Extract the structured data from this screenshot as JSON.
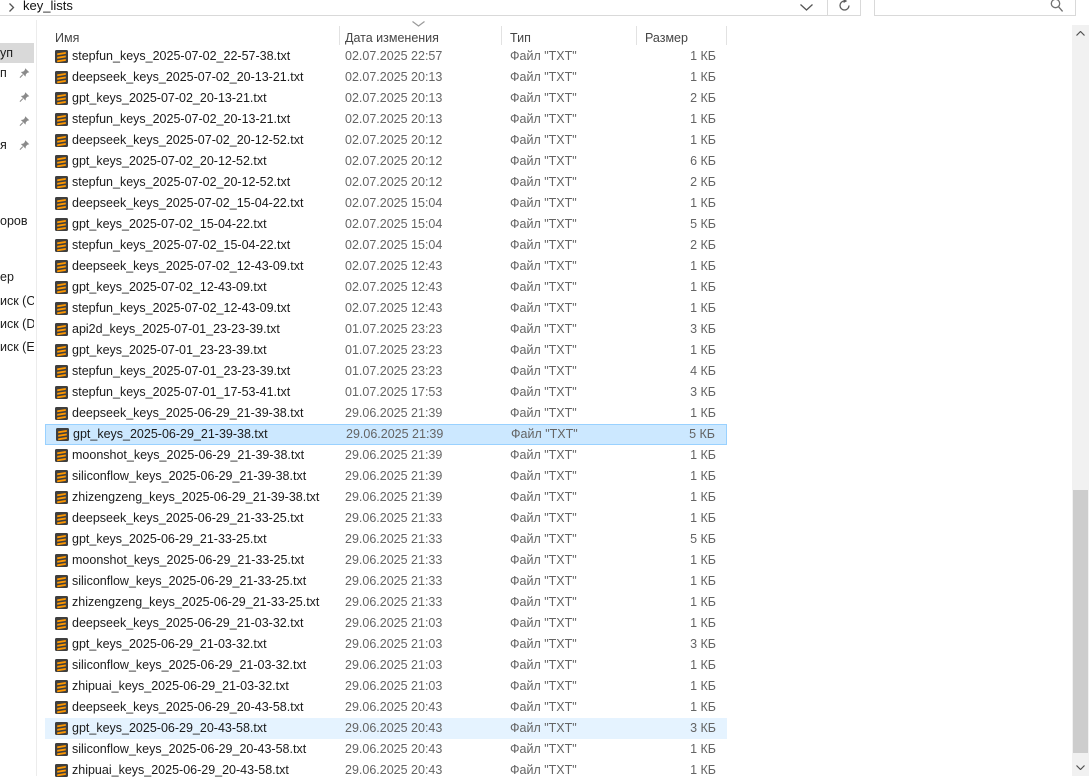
{
  "colors": {
    "selection_bg": "#cce8ff",
    "selection_border": "#99d1ff",
    "hover_bg": "#e5f3ff",
    "nav_selected_bg": "#d9d9d9",
    "file_icon_bg": "#3f3f3f",
    "file_icon_accent": "#ff9800"
  },
  "address_bar": {
    "breadcrumb_chevron_icon": "chevron-right",
    "path_segment": "key_lists",
    "dropdown_icon": "chevron-down",
    "refresh_icon": "refresh"
  },
  "search_box": {
    "value": "",
    "icon": "magnifier"
  },
  "nav_pane": {
    "items": [
      {
        "label_fragment": "уп",
        "selected": true,
        "pinned": false
      },
      {
        "label_fragment": "п",
        "selected": false,
        "pinned": true
      },
      {
        "label_fragment": "",
        "selected": false,
        "pinned": true
      },
      {
        "label_fragment": "",
        "selected": false,
        "pinned": true
      },
      {
        "label_fragment": "я",
        "selected": false,
        "pinned": true
      },
      {
        "label_fragment": "оров",
        "selected": false,
        "pinned": false
      },
      {
        "label_fragment": "ер",
        "selected": false,
        "pinned": false
      },
      {
        "label_fragment": "иск (C",
        "selected": false,
        "pinned": false
      },
      {
        "label_fragment": "иск (D",
        "selected": false,
        "pinned": false
      },
      {
        "label_fragment": "иск (E",
        "selected": false,
        "pinned": false
      }
    ]
  },
  "file_list": {
    "columns": [
      {
        "label": "Имя"
      },
      {
        "label": "Дата изменения",
        "sorted": "desc",
        "sort_icon": "chevron-down"
      },
      {
        "label": "Тип"
      },
      {
        "label": "Размер"
      }
    ],
    "rows": [
      {
        "name": "stepfun_keys_2025-07-02_22-57-38.txt",
        "date_modified": "02.07.2025 22:57",
        "type": "Файл \"TXT\"",
        "size": "1 КБ",
        "state": ""
      },
      {
        "name": "deepseek_keys_2025-07-02_20-13-21.txt",
        "date_modified": "02.07.2025 20:13",
        "type": "Файл \"TXT\"",
        "size": "1 КБ",
        "state": ""
      },
      {
        "name": "gpt_keys_2025-07-02_20-13-21.txt",
        "date_modified": "02.07.2025 20:13",
        "type": "Файл \"TXT\"",
        "size": "2 КБ",
        "state": ""
      },
      {
        "name": "stepfun_keys_2025-07-02_20-13-21.txt",
        "date_modified": "02.07.2025 20:13",
        "type": "Файл \"TXT\"",
        "size": "1 КБ",
        "state": ""
      },
      {
        "name": "deepseek_keys_2025-07-02_20-12-52.txt",
        "date_modified": "02.07.2025 20:12",
        "type": "Файл \"TXT\"",
        "size": "1 КБ",
        "state": ""
      },
      {
        "name": "gpt_keys_2025-07-02_20-12-52.txt",
        "date_modified": "02.07.2025 20:12",
        "type": "Файл \"TXT\"",
        "size": "6 КБ",
        "state": ""
      },
      {
        "name": "stepfun_keys_2025-07-02_20-12-52.txt",
        "date_modified": "02.07.2025 20:12",
        "type": "Файл \"TXT\"",
        "size": "2 КБ",
        "state": ""
      },
      {
        "name": "deepseek_keys_2025-07-02_15-04-22.txt",
        "date_modified": "02.07.2025 15:04",
        "type": "Файл \"TXT\"",
        "size": "1 КБ",
        "state": ""
      },
      {
        "name": "gpt_keys_2025-07-02_15-04-22.txt",
        "date_modified": "02.07.2025 15:04",
        "type": "Файл \"TXT\"",
        "size": "5 КБ",
        "state": ""
      },
      {
        "name": "stepfun_keys_2025-07-02_15-04-22.txt",
        "date_modified": "02.07.2025 15:04",
        "type": "Файл \"TXT\"",
        "size": "2 КБ",
        "state": ""
      },
      {
        "name": "deepseek_keys_2025-07-02_12-43-09.txt",
        "date_modified": "02.07.2025 12:43",
        "type": "Файл \"TXT\"",
        "size": "1 КБ",
        "state": ""
      },
      {
        "name": "gpt_keys_2025-07-02_12-43-09.txt",
        "date_modified": "02.07.2025 12:43",
        "type": "Файл \"TXT\"",
        "size": "1 КБ",
        "state": ""
      },
      {
        "name": "stepfun_keys_2025-07-02_12-43-09.txt",
        "date_modified": "02.07.2025 12:43",
        "type": "Файл \"TXT\"",
        "size": "1 КБ",
        "state": ""
      },
      {
        "name": "api2d_keys_2025-07-01_23-23-39.txt",
        "date_modified": "01.07.2025 23:23",
        "type": "Файл \"TXT\"",
        "size": "3 КБ",
        "state": ""
      },
      {
        "name": "gpt_keys_2025-07-01_23-23-39.txt",
        "date_modified": "01.07.2025 23:23",
        "type": "Файл \"TXT\"",
        "size": "1 КБ",
        "state": ""
      },
      {
        "name": "stepfun_keys_2025-07-01_23-23-39.txt",
        "date_modified": "01.07.2025 23:23",
        "type": "Файл \"TXT\"",
        "size": "4 КБ",
        "state": ""
      },
      {
        "name": "stepfun_keys_2025-07-01_17-53-41.txt",
        "date_modified": "01.07.2025 17:53",
        "type": "Файл \"TXT\"",
        "size": "3 КБ",
        "state": ""
      },
      {
        "name": "deepseek_keys_2025-06-29_21-39-38.txt",
        "date_modified": "29.06.2025 21:39",
        "type": "Файл \"TXT\"",
        "size": "1 КБ",
        "state": ""
      },
      {
        "name": "gpt_keys_2025-06-29_21-39-38.txt",
        "date_modified": "29.06.2025 21:39",
        "type": "Файл \"TXT\"",
        "size": "5 КБ",
        "state": "selected"
      },
      {
        "name": "moonshot_keys_2025-06-29_21-39-38.txt",
        "date_modified": "29.06.2025 21:39",
        "type": "Файл \"TXT\"",
        "size": "1 КБ",
        "state": ""
      },
      {
        "name": "siliconflow_keys_2025-06-29_21-39-38.txt",
        "date_modified": "29.06.2025 21:39",
        "type": "Файл \"TXT\"",
        "size": "1 КБ",
        "state": ""
      },
      {
        "name": "zhizengzeng_keys_2025-06-29_21-39-38.txt",
        "date_modified": "29.06.2025 21:39",
        "type": "Файл \"TXT\"",
        "size": "1 КБ",
        "state": ""
      },
      {
        "name": "deepseek_keys_2025-06-29_21-33-25.txt",
        "date_modified": "29.06.2025 21:33",
        "type": "Файл \"TXT\"",
        "size": "1 КБ",
        "state": ""
      },
      {
        "name": "gpt_keys_2025-06-29_21-33-25.txt",
        "date_modified": "29.06.2025 21:33",
        "type": "Файл \"TXT\"",
        "size": "5 КБ",
        "state": ""
      },
      {
        "name": "moonshot_keys_2025-06-29_21-33-25.txt",
        "date_modified": "29.06.2025 21:33",
        "type": "Файл \"TXT\"",
        "size": "1 КБ",
        "state": ""
      },
      {
        "name": "siliconflow_keys_2025-06-29_21-33-25.txt",
        "date_modified": "29.06.2025 21:33",
        "type": "Файл \"TXT\"",
        "size": "1 КБ",
        "state": ""
      },
      {
        "name": "zhizengzeng_keys_2025-06-29_21-33-25.txt",
        "date_modified": "29.06.2025 21:33",
        "type": "Файл \"TXT\"",
        "size": "1 КБ",
        "state": ""
      },
      {
        "name": "deepseek_keys_2025-06-29_21-03-32.txt",
        "date_modified": "29.06.2025 21:03",
        "type": "Файл \"TXT\"",
        "size": "1 КБ",
        "state": ""
      },
      {
        "name": "gpt_keys_2025-06-29_21-03-32.txt",
        "date_modified": "29.06.2025 21:03",
        "type": "Файл \"TXT\"",
        "size": "3 КБ",
        "state": ""
      },
      {
        "name": "siliconflow_keys_2025-06-29_21-03-32.txt",
        "date_modified": "29.06.2025 21:03",
        "type": "Файл \"TXT\"",
        "size": "1 КБ",
        "state": ""
      },
      {
        "name": "zhipuai_keys_2025-06-29_21-03-32.txt",
        "date_modified": "29.06.2025 21:03",
        "type": "Файл \"TXT\"",
        "size": "1 КБ",
        "state": ""
      },
      {
        "name": "deepseek_keys_2025-06-29_20-43-58.txt",
        "date_modified": "29.06.2025 20:43",
        "type": "Файл \"TXT\"",
        "size": "1 КБ",
        "state": ""
      },
      {
        "name": "gpt_keys_2025-06-29_20-43-58.txt",
        "date_modified": "29.06.2025 20:43",
        "type": "Файл \"TXT\"",
        "size": "3 КБ",
        "state": "hover"
      },
      {
        "name": "siliconflow_keys_2025-06-29_20-43-58.txt",
        "date_modified": "29.06.2025 20:43",
        "type": "Файл \"TXT\"",
        "size": "1 КБ",
        "state": ""
      },
      {
        "name": "zhipuai_keys_2025-06-29_20-43-58.txt",
        "date_modified": "29.06.2025 20:43",
        "type": "Файл \"TXT\"",
        "size": "1 КБ",
        "state": ""
      }
    ]
  },
  "scrollbar": {
    "up_icon": "chevron-up",
    "down_icon": "chevron-down"
  }
}
